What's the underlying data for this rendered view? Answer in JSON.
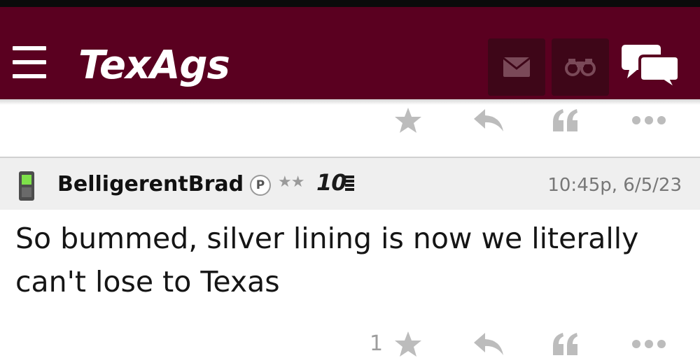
{
  "header": {
    "logo_text": "TexAgs",
    "background_color": "#5a0020",
    "icons": {
      "menu": "hamburger-menu-icon",
      "mail": "mail-icon",
      "binoculars": "binoculars-icon",
      "chat": "chat-bubbles-icon"
    }
  },
  "previous_post_actions": {
    "icons": [
      "star-icon",
      "reply-arrow-icon",
      "quote-icon",
      "more-dots-icon"
    ]
  },
  "post": {
    "username": "BelligerentBrad",
    "badge": "P",
    "rank_stars": "★★",
    "rank_number": "10",
    "timestamp": "10:45p, 6/5/23",
    "body": "So bummed, silver lining is now we literally can't lose to Texas",
    "star_count": "1"
  },
  "colors": {
    "maroon": "#5a0020",
    "button_dark": "#3e0618",
    "action_icon_gray": "#bcbcbc"
  }
}
